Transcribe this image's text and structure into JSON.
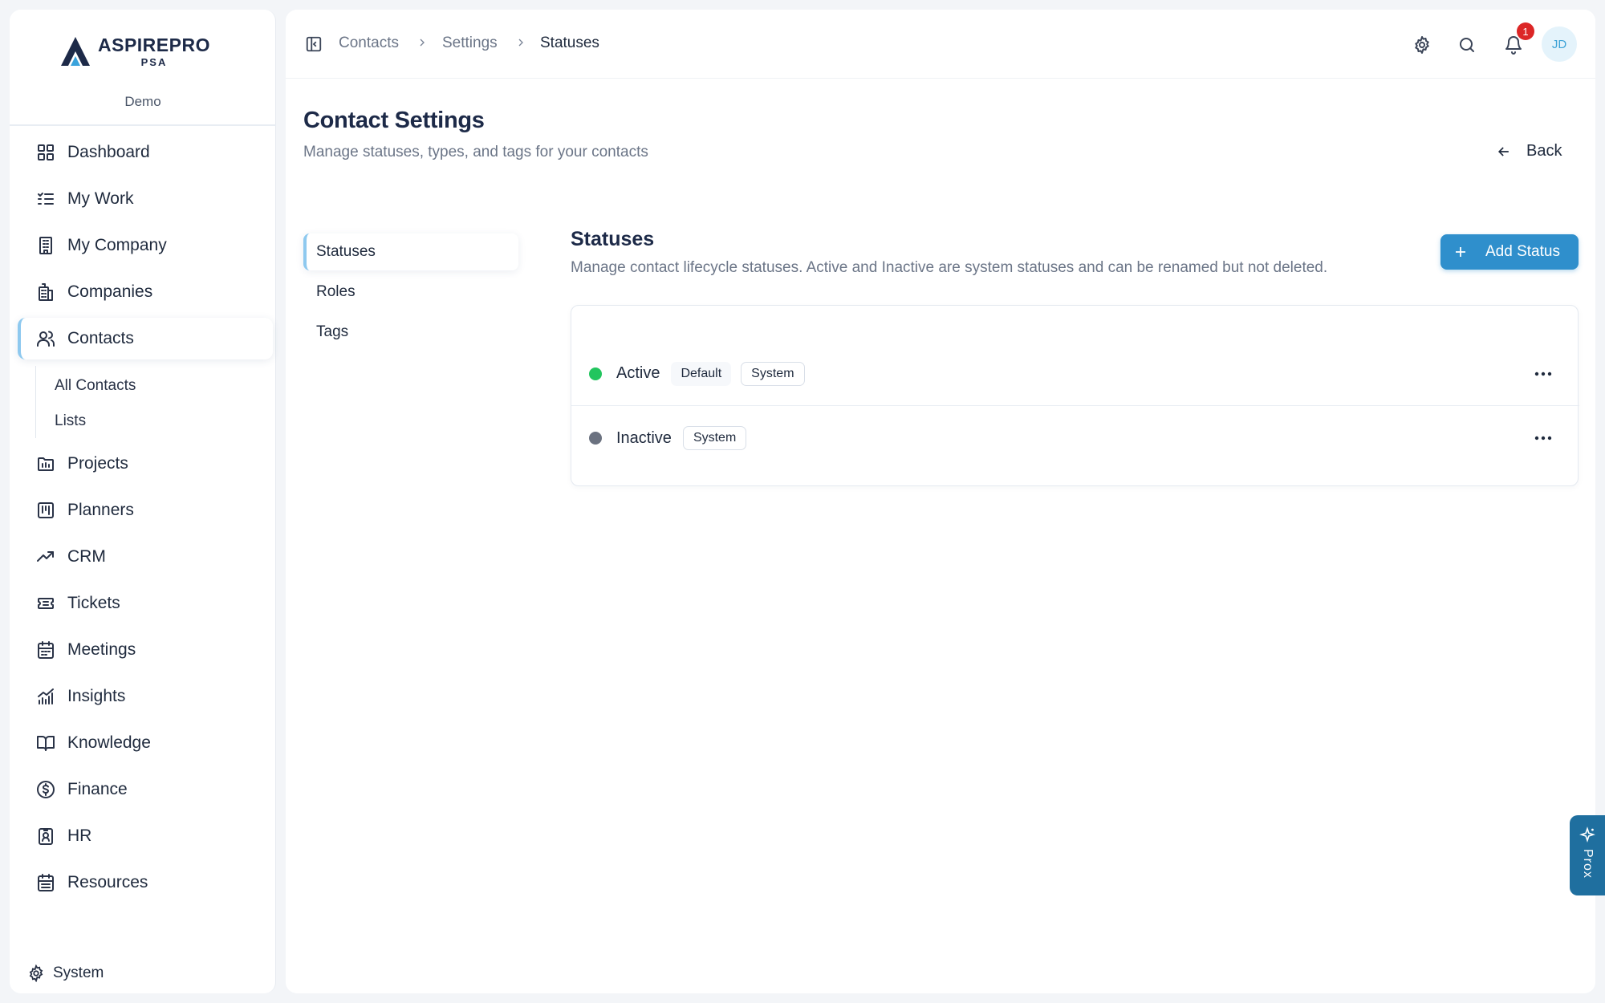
{
  "brand": {
    "name": "ASPIREPRO",
    "sub": "PSA",
    "org": "Demo"
  },
  "nav": {
    "items": [
      {
        "label": "Dashboard",
        "icon": "dashboard-icon"
      },
      {
        "label": "My Work",
        "icon": "checklist-icon"
      },
      {
        "label": "My Company",
        "icon": "building-icon"
      },
      {
        "label": "Companies",
        "icon": "companies-icon"
      },
      {
        "label": "Contacts",
        "icon": "users-icon",
        "active": true
      },
      {
        "label": "Projects",
        "icon": "folder-icon"
      },
      {
        "label": "Planners",
        "icon": "kanban-icon"
      },
      {
        "label": "CRM",
        "icon": "trend-icon"
      },
      {
        "label": "Tickets",
        "icon": "ticket-icon"
      },
      {
        "label": "Meetings",
        "icon": "calendar-icon"
      },
      {
        "label": "Insights",
        "icon": "chart-icon"
      },
      {
        "label": "Knowledge",
        "icon": "book-icon"
      },
      {
        "label": "Finance",
        "icon": "dollar-icon"
      },
      {
        "label": "HR",
        "icon": "badge-icon"
      },
      {
        "label": "Resources",
        "icon": "calendar-grid-icon"
      }
    ],
    "contacts_sub": [
      "All Contacts",
      "Lists"
    ],
    "system": "System"
  },
  "breadcrumb": [
    "Contacts",
    "Settings",
    "Statuses"
  ],
  "topbar": {
    "notification_count": "1",
    "avatar_initials": "JD"
  },
  "page": {
    "title": "Contact Settings",
    "subtitle": "Manage statuses, types, and tags for your contacts",
    "back_label": "Back"
  },
  "tabs": [
    "Statuses",
    "Roles",
    "Tags"
  ],
  "section": {
    "title": "Statuses",
    "subtitle": "Manage contact lifecycle statuses. Active and Inactive are system statuses and can be renamed but not deleted.",
    "add_button": "Add Status"
  },
  "statuses": [
    {
      "name": "Active",
      "color": "#22c55e",
      "badges": [
        "Default",
        "System"
      ]
    },
    {
      "name": "Inactive",
      "color": "#6b7280",
      "badges": [
        "System"
      ]
    }
  ],
  "assistant": {
    "label": "Prox"
  },
  "colors": {
    "accent": "#2f8fcc",
    "active_border": "#8ec9ef",
    "badge_red": "#dc2626"
  }
}
